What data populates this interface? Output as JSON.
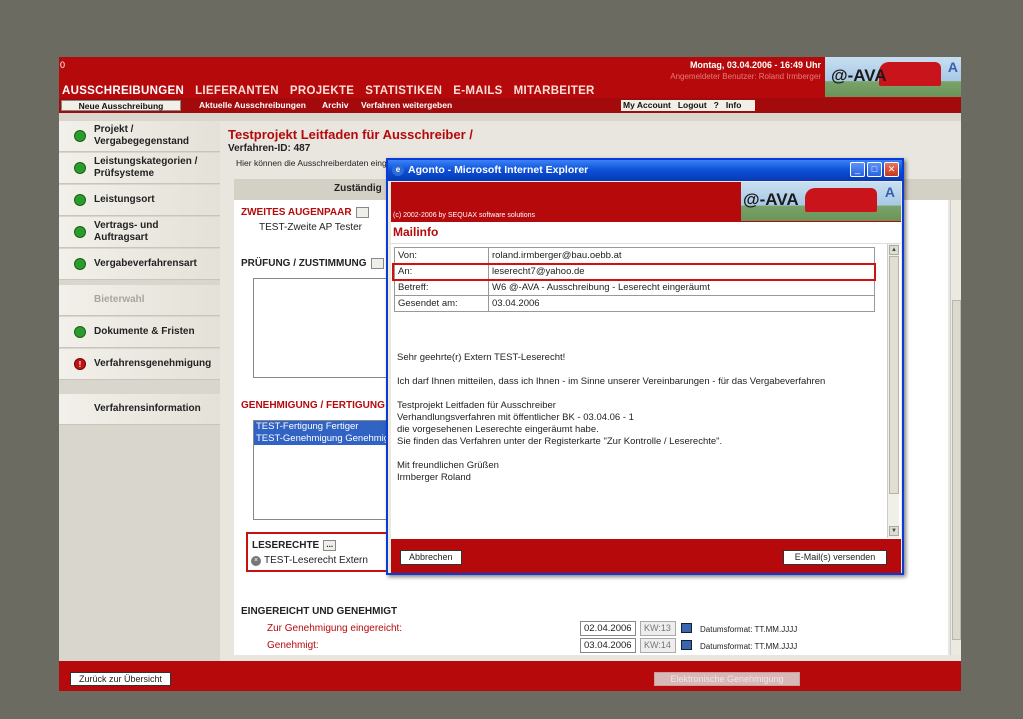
{
  "header": {
    "corner": "0",
    "date": "Montag, 03.04.2006 - 16:49 Uhr",
    "logged_in": "Angemeldeter Benutzer: Roland Irmberger",
    "logo_text": "@-AVA",
    "logo_mark": "A",
    "nav": [
      "AUSSCHREIBUNGEN",
      "LIEFERANTEN",
      "PROJEKTE",
      "STATISTIKEN",
      "E-MAILS",
      "MITARBEITER"
    ]
  },
  "subnav": {
    "new_button": "Neue Ausschreibung",
    "links": [
      "Aktuelle Ausschreibungen",
      "Archiv",
      "Verfahren weitergeben"
    ],
    "right": [
      "My Account",
      "Logout",
      "?",
      "Info"
    ]
  },
  "sidebar": {
    "items": [
      {
        "label": "Projekt / Vergabegegenstand",
        "status": "ok"
      },
      {
        "label": "Leistungskategorien / Prüfsysteme",
        "status": "ok"
      },
      {
        "label": "Leistungsort",
        "status": "ok"
      },
      {
        "label": "Vertrags- und Auftragsart",
        "status": "ok"
      },
      {
        "label": "Vergabeverfahrensart",
        "status": "ok"
      },
      {
        "label": "Bieterwahl",
        "status": "disabled"
      },
      {
        "label": "Dokumente & Fristen",
        "status": "ok"
      },
      {
        "label": "Verfahrensgenehmigung",
        "status": "warn"
      },
      {
        "label": "Verfahrensinformation",
        "status": "none"
      }
    ]
  },
  "main": {
    "title": "Testprojekt Leitfaden für Ausschreiber /",
    "procedure_id": "Verfahren-ID: 487",
    "hint": "Hier können die Ausschreiberdaten eingesehen werden.",
    "tab": "Zuständig",
    "section_ap": "ZWEITES AUGENPAAR",
    "ap_value": "TEST-Zweite AP Tester",
    "section_pruefung": "PRÜFUNG / ZUSTIMMUNG",
    "section_genehmigung": "GENEHMIGUNG / FERTIGUNG",
    "genehmigung_items": [
      "TEST-Fertigung Fertiger",
      "TEST-Genehmigung Genehmiger"
    ],
    "section_leserechte": "LESERECHTE",
    "leserecht_entry": "TEST-Leserecht Extern",
    "dots": "...",
    "section_eingereicht": "EINGEREICHT UND GENEHMIGT",
    "rows": [
      {
        "label": "Zur Genehmigung eingereicht:",
        "date": "02.04.2006",
        "kw": "KW:13",
        "format": "Datumsformat: TT.MM.JJJJ"
      },
      {
        "label": "Genehmigt:",
        "date": "03.04.2006",
        "kw": "KW:14",
        "format": "Datumsformat: TT.MM.JJJJ"
      }
    ]
  },
  "footer": {
    "back": "Zurück zur Übersicht",
    "electronic": "Elektronische Genehmigung"
  },
  "popup": {
    "title": "Agonto - Microsoft Internet Explorer",
    "copyright": "(c) 2002-2006 by SEQUAX software solutions",
    "heading": "Mailinfo",
    "fields": [
      {
        "key": "Von:",
        "value": "roland.irmberger@bau.oebb.at"
      },
      {
        "key": "An:",
        "value": "leserecht7@yahoo.de"
      },
      {
        "key": "Betreff:",
        "value": "W6 @-AVA - Ausschreibung - Leserecht eingeräumt"
      },
      {
        "key": "Gesendet am:",
        "value": "03.04.2006"
      }
    ],
    "body": {
      "greeting": "Sehr geehrte(r) Extern TEST-Leserecht!",
      "p1": "Ich darf Ihnen mitteilen, dass ich Ihnen - im Sinne unserer Vereinbarungen - für das Vergabeverfahren",
      "p2a": "Testprojekt Leitfaden für Ausschreiber",
      "p2b": "Verhandlungsverfahren mit öffentlicher BK - 03.04.06 - 1",
      "p2c": "die vorgesehenen Leserechte eingeräumt habe.",
      "p2d": "Sie finden das Verfahren unter der Registerkarte \"Zur Kontrolle / Leserechte\".",
      "closing": "Mit freundlichen Grüßen",
      "signature": "Irmberger Roland"
    },
    "cancel": "Abbrechen",
    "send": "E-Mail(s) versenden"
  }
}
